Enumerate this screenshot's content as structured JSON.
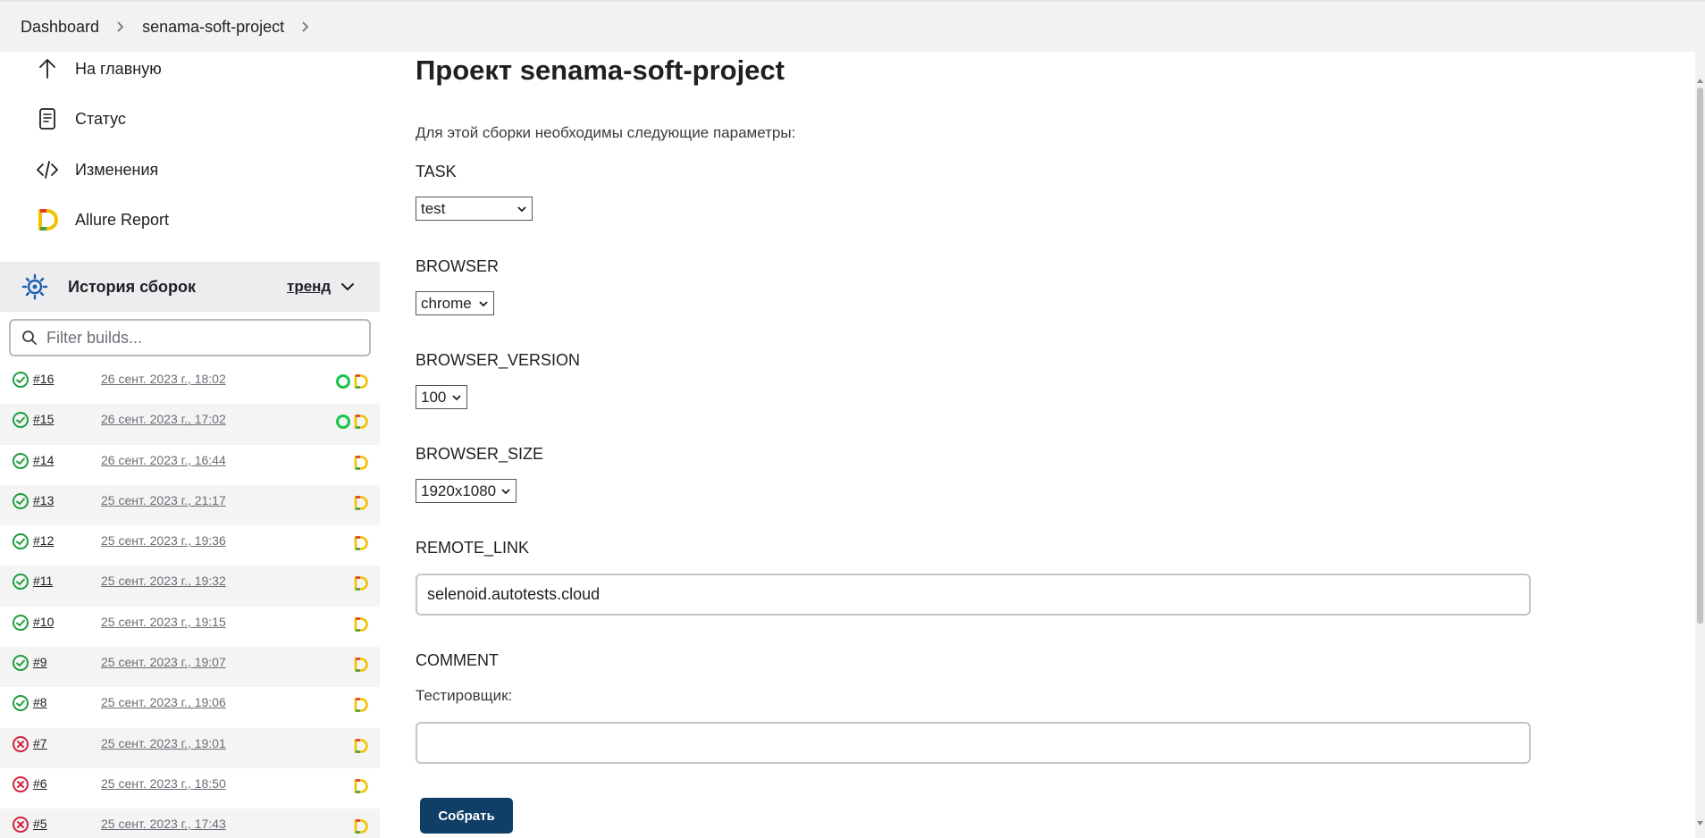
{
  "breadcrumb": {
    "items": [
      "Dashboard",
      "senama-soft-project"
    ]
  },
  "sidebar": {
    "tasks": [
      {
        "label": "На главную",
        "icon": "arrow-up-icon"
      },
      {
        "label": "Статус",
        "icon": "document-icon"
      },
      {
        "label": "Изменения",
        "icon": "code-icon"
      },
      {
        "label": "Allure Report",
        "icon": "allure-icon"
      }
    ],
    "history": {
      "title": "История сборок",
      "trend_label": "тренд"
    },
    "filter": {
      "placeholder": "Filter builds..."
    },
    "builds": [
      {
        "number": "#16",
        "date": "26 сент. 2023 г., 18:02",
        "status": "success",
        "badges": [
          "allure-circle",
          "allure"
        ]
      },
      {
        "number": "#15",
        "date": "26 сент. 2023 г., 17:02",
        "status": "success",
        "badges": [
          "allure-circle",
          "allure"
        ]
      },
      {
        "number": "#14",
        "date": "26 сент. 2023 г., 16:44",
        "status": "success",
        "badges": [
          "allure"
        ]
      },
      {
        "number": "#13",
        "date": "25 сент. 2023 г., 21:17",
        "status": "success",
        "badges": [
          "allure"
        ]
      },
      {
        "number": "#12",
        "date": "25 сент. 2023 г., 19:36",
        "status": "success",
        "badges": [
          "allure"
        ]
      },
      {
        "number": "#11",
        "date": "25 сент. 2023 г., 19:32",
        "status": "success",
        "badges": [
          "allure"
        ]
      },
      {
        "number": "#10",
        "date": "25 сент. 2023 г., 19:15",
        "status": "success",
        "badges": [
          "allure"
        ]
      },
      {
        "number": "#9",
        "date": "25 сент. 2023 г., 19:07",
        "status": "success",
        "badges": [
          "allure"
        ]
      },
      {
        "number": "#8",
        "date": "25 сент. 2023 г., 19:06",
        "status": "success",
        "badges": [
          "allure"
        ]
      },
      {
        "number": "#7",
        "date": "25 сент. 2023 г., 19:01",
        "status": "failed",
        "badges": [
          "allure"
        ]
      },
      {
        "number": "#6",
        "date": "25 сент. 2023 г., 18:50",
        "status": "failed",
        "badges": [
          "allure"
        ]
      },
      {
        "number": "#5",
        "date": "25 сент. 2023 г., 17:43",
        "status": "failed",
        "badges": [
          "allure"
        ]
      }
    ]
  },
  "main": {
    "title": "Проект senama-soft-project",
    "intro": "Для этой сборки необходимы следующие параметры:",
    "params": {
      "task": {
        "label": "TASK",
        "value": "test"
      },
      "browser": {
        "label": "BROWSER",
        "value": "chrome"
      },
      "browser_version": {
        "label": "BROWSER_VERSION",
        "value": "100"
      },
      "browser_size": {
        "label": "BROWSER_SIZE",
        "value": "1920x1080"
      },
      "remote_link": {
        "label": "REMOTE_LINK",
        "value": "selenoid.autotests.cloud"
      },
      "comment": {
        "label": "COMMENT",
        "description": "Тестировщик:",
        "value": ""
      }
    },
    "submit_label": "Собрать"
  },
  "colors": {
    "success": "#1e9e3e",
    "failed": "#d2233c",
    "submit_bg": "#0f3e66",
    "history_header_bg": "#ededf0"
  }
}
